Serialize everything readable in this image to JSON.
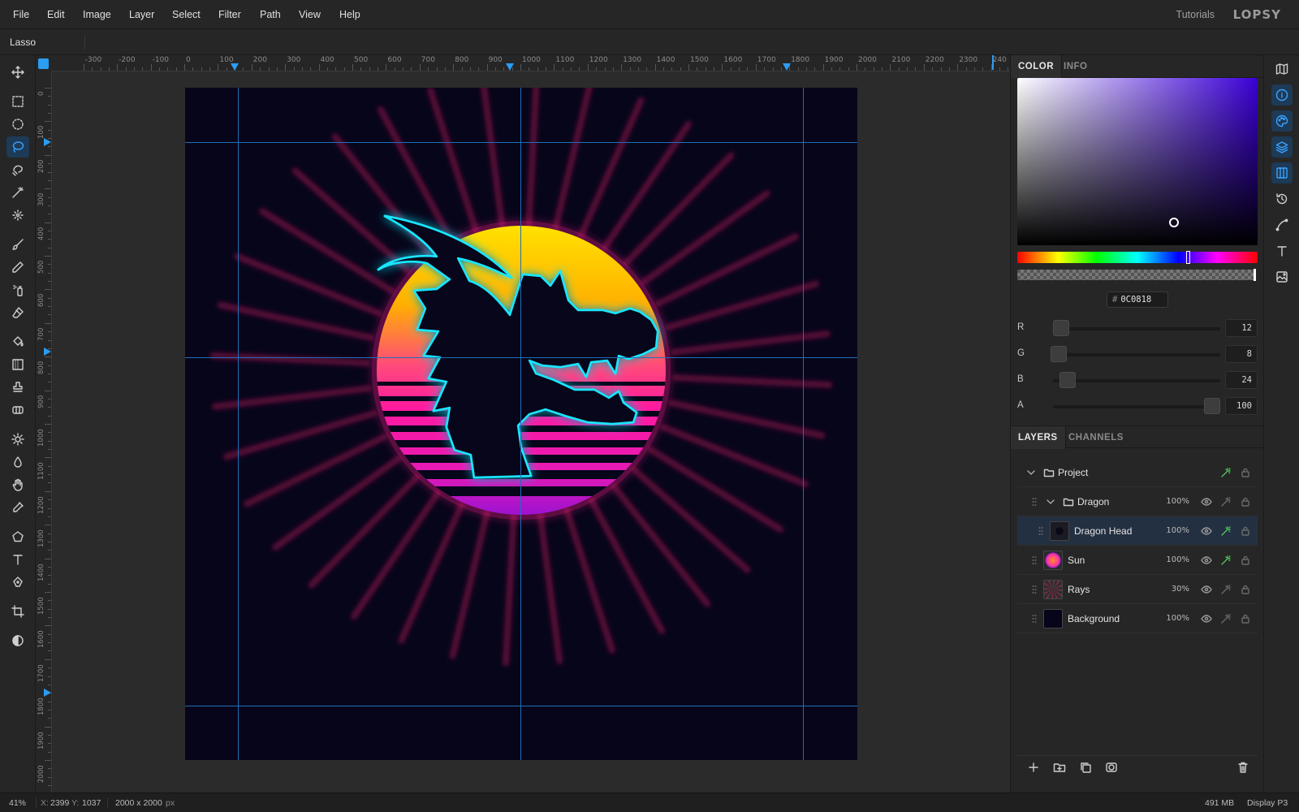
{
  "menubar": {
    "items": [
      "File",
      "Edit",
      "Image",
      "Layer",
      "Select",
      "Filter",
      "Path",
      "View",
      "Help"
    ],
    "tutorials": "Tutorials",
    "brand": "LOPSY"
  },
  "options_bar": {
    "tool_name": "Lasso"
  },
  "toolbar": {
    "tools": [
      "move",
      "rect-select",
      "ellipse-select",
      "lasso",
      "magnetic-lasso",
      "magic-wand",
      "quick-select",
      "brush",
      "pencil",
      "spray",
      "eraser",
      "fill",
      "gradient",
      "stamp",
      "heal",
      "brightness",
      "blur",
      "hand",
      "eyedropper",
      "polygon",
      "text",
      "pen",
      "crop",
      "contrast"
    ],
    "active_tool": "lasso"
  },
  "rulers": {
    "horizontal": [
      "-300",
      "-200",
      "-100",
      "0",
      "100",
      "200",
      "300",
      "400",
      "500",
      "600",
      "700",
      "800",
      "900",
      "1000",
      "1100",
      "1200",
      "1300",
      "1400",
      "1500",
      "1600",
      "1700",
      "1800",
      "1900",
      "2000",
      "2100",
      "2200",
      "2300",
      "240"
    ],
    "vertical": [
      "0",
      "100",
      "200",
      "300",
      "400",
      "500",
      "600",
      "700",
      "800",
      "900",
      "1000",
      "1100",
      "1200",
      "1300",
      "1400",
      "1500",
      "1600",
      "1700",
      "1800",
      "1900",
      "2000"
    ]
  },
  "color_panel": {
    "tabs": [
      "COLOR",
      "INFO"
    ],
    "active_tab": "COLOR",
    "hex": "0C0818",
    "channels": [
      {
        "label": "R",
        "value": "12"
      },
      {
        "label": "G",
        "value": "8"
      },
      {
        "label": "B",
        "value": "24"
      },
      {
        "label": "A",
        "value": "100"
      }
    ]
  },
  "layers_panel": {
    "tabs": [
      "LAYERS",
      "CHANNELS"
    ],
    "active_tab": "LAYERS",
    "layers": [
      {
        "name": "Project",
        "type": "group",
        "opacity": "",
        "level": 0
      },
      {
        "name": "Dragon",
        "type": "group",
        "opacity": "100%",
        "level": 1
      },
      {
        "name": "Dragon Head",
        "type": "layer",
        "opacity": "100%",
        "level": 2,
        "selected": true
      },
      {
        "name": "Sun",
        "type": "layer",
        "opacity": "100%",
        "level": 1
      },
      {
        "name": "Rays",
        "type": "layer",
        "opacity": "30%",
        "level": 1
      },
      {
        "name": "Background",
        "type": "layer",
        "opacity": "100%",
        "level": 1
      }
    ]
  },
  "statusbar": {
    "zoom": "41%",
    "x_label": "X:",
    "x": "2399",
    "y_label": "Y:",
    "y": "1037",
    "doc_size": "2000 x 2000",
    "doc_unit": "px",
    "memory": "491 MB",
    "display": "Display P3"
  },
  "colors": {
    "accent": "#2a9df4",
    "canvas_bg": "#06051a",
    "neon_outline": "#19e6ff",
    "fx_on": "#4fc15a"
  }
}
